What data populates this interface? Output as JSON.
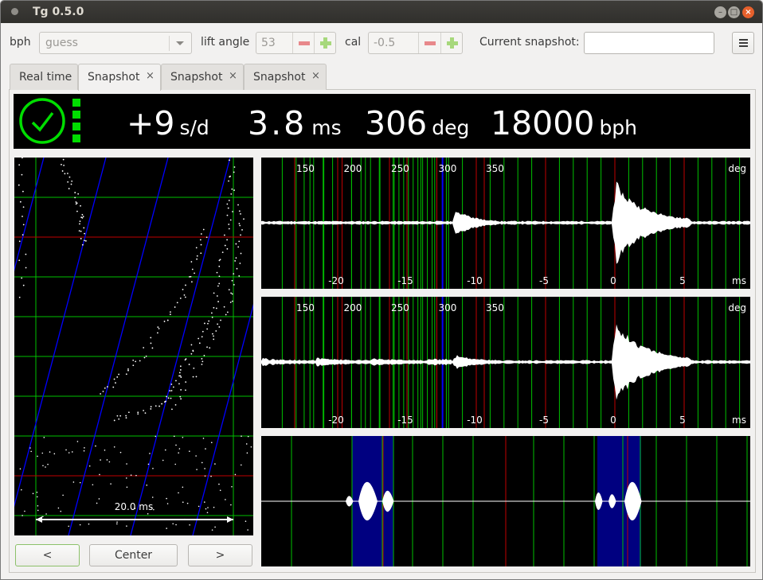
{
  "window": {
    "title": "Tg 0.5.0"
  },
  "toolbar": {
    "bph_label": "bph",
    "bph_value": "guess",
    "lift_angle_label": "lift angle",
    "lift_angle_value": "53",
    "cal_label": "cal",
    "cal_value": "-0.5",
    "snapshot_label": "Current snapshot:",
    "snapshot_value": ""
  },
  "tabs": [
    {
      "label": "Real time",
      "closable": false
    },
    {
      "label": "Snapshot",
      "closable": true,
      "active": true
    },
    {
      "label": "Snapshot",
      "closable": true
    },
    {
      "label": "Snapshot",
      "closable": true
    }
  ],
  "close_glyph": "×",
  "status": {
    "rate": "+9",
    "rate_unit": "s/d",
    "beat_error": "3.8",
    "beat_error_unit": "ms",
    "amplitude": "306",
    "amplitude_unit": "deg",
    "bph": "18000",
    "bph_unit": "bph",
    "indicator_color": "#00dd00"
  },
  "paperstrip": {
    "scale_label": "20.0 ms"
  },
  "waveforms": {
    "deg_ticks": [
      "150",
      "200",
      "250",
      "300",
      "350"
    ],
    "deg_unit": "deg",
    "ms_ticks": [
      "-20",
      "-15",
      "-10",
      "-5",
      "0",
      "5"
    ],
    "ms_unit": "ms"
  },
  "buttons": {
    "prev": "<",
    "center": "Center",
    "next": ">"
  },
  "colors": {
    "grid_green": "#00c000",
    "grid_red": "#c00000",
    "trace_blue": "#0000ff",
    "highlight_blue": "#000080"
  }
}
